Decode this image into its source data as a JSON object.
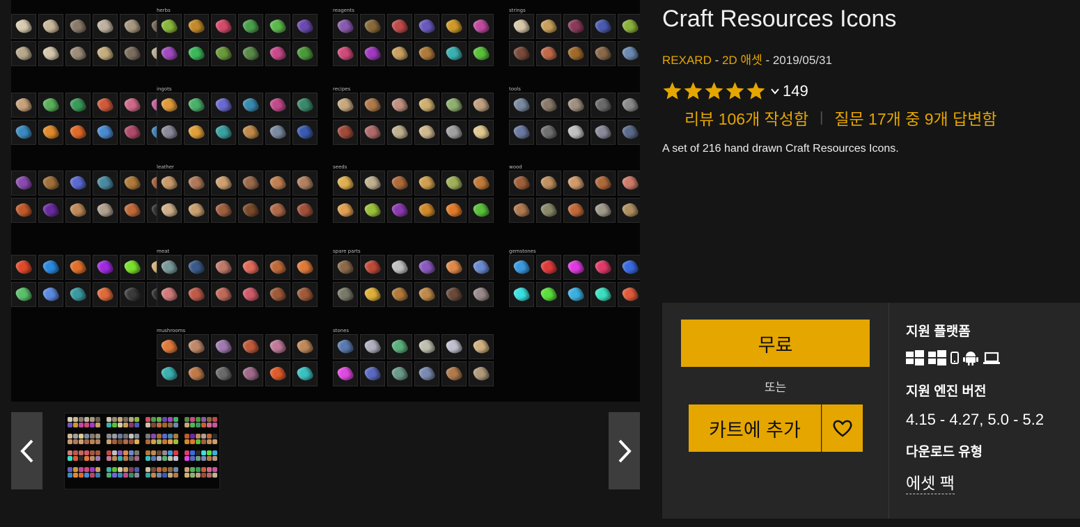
{
  "product": {
    "title": "Craft Resources Icons",
    "seller": "REXARD",
    "category": "2D 애셋",
    "date": "2019/05/31",
    "sep1": " - ",
    "sep2": " - ",
    "sep3": " - ",
    "rating": 5,
    "rating_count": "149",
    "reviews_link": "리뷰 106개 작성함",
    "review_sep": "|",
    "questions_link": "질문 17개 중 9개 답변함",
    "description": "A set of 216 hand drawn Craft Resources Icons."
  },
  "gallery": {
    "categories": [
      {
        "label": "",
        "colors": [
          "#d9cbb0",
          "#c9b89a",
          "#8a7a6a",
          "#bfb2a0",
          "#a89880",
          "#6d6252",
          "#b8a98c",
          "#d4c6ac",
          "#9c8c78",
          "#c6ad7f",
          "#7c6e5e",
          "#b5a78f"
        ]
      },
      {
        "label": "herbs",
        "colors": [
          "#8ab83a",
          "#c48a2a",
          "#d64a6a",
          "#4aa04a",
          "#5cb84a",
          "#6a4ab0",
          "#a04ac0",
          "#3ab85a",
          "#6a9a3a",
          "#5a8a4a",
          "#c84a8a",
          "#4a9a3a"
        ]
      },
      {
        "label": "reagents",
        "colors": [
          "#8a5ab0",
          "#8a6a3a",
          "#c04a4a",
          "#6a5ac0",
          "#d09a2a",
          "#c04aa0",
          "#d04a7a",
          "#a03ac0",
          "#c8a060",
          "#b07a3a",
          "#3ab0b0",
          "#5ac03a"
        ]
      },
      {
        "label": "strings",
        "colors": [
          "#d8c8a8",
          "#c8a05a",
          "#8a3a5a",
          "#4a5ab0",
          "#8ab03a",
          "#d0c0a0",
          "#7a4a3a",
          "#c06a4a",
          "#a06a2a",
          "#8a6a4a",
          "#6a8ab0",
          "#3a9ac0"
        ]
      },
      {
        "label": "",
        "colors": [
          "#c8a27a",
          "#5ab05a",
          "#3a9a5a",
          "#d05a3a",
          "#d06a8a",
          "#c05a9a",
          "#3a8ac0",
          "#e08a2a",
          "#e06a2a",
          "#4a8ad0",
          "#b04a6a",
          "#3a7ab0"
        ]
      },
      {
        "label": "ingots",
        "colors": [
          "#e09a3a",
          "#4ab06a",
          "#6a6ad0",
          "#3a8ab0",
          "#c04a8a",
          "#3a8a6a",
          "#8a8a9a",
          "#e0a03a",
          "#3aa0a0",
          "#c08a4a",
          "#7a8aa0",
          "#3a5ab0"
        ]
      },
      {
        "label": "recipes",
        "colors": [
          "#c8a880",
          "#b07a4a",
          "#c09080",
          "#d0b070",
          "#90b070",
          "#c0a080",
          "#a04a3a",
          "#b06a6a",
          "#c0b090",
          "#d0b890",
          "#a0a0a0",
          "#e0c890"
        ]
      },
      {
        "label": "tools",
        "colors": [
          "#7a8aa0",
          "#8a7a6a",
          "#a09080",
          "#6a6a6a",
          "#8a8a8a",
          "#9a9aa0",
          "#6a7aa0",
          "#707070",
          "#c0c0c0",
          "#8a8a9a",
          "#5a6a8a",
          "#7a7a7a"
        ]
      },
      {
        "label": "",
        "colors": [
          "#8a4ab0",
          "#a0703a",
          "#5a6ad0",
          "#4a8aa0",
          "#b07a3a",
          "#a05a3a",
          "#c05a2a",
          "#6a2aa0",
          "#c08a5a",
          "#b0a090",
          "#c06a3a",
          "#2a2a2a"
        ]
      },
      {
        "label": "leather",
        "colors": [
          "#c89a6a",
          "#b07a5a",
          "#d0a070",
          "#9a6a4a",
          "#c08050",
          "#b08060",
          "#d0b08a",
          "#c8a070",
          "#a06040",
          "#7a4a2a",
          "#b06a4a",
          "#a0503a"
        ]
      },
      {
        "label": "seeds",
        "colors": [
          "#e0b050",
          "#c0b090",
          "#b06a3a",
          "#d0a050",
          "#a0b05a",
          "#c07a3a",
          "#e0a050",
          "#9ac03a",
          "#8a3ab0",
          "#d08a2a",
          "#e07a2a",
          "#5ac03a"
        ]
      },
      {
        "label": "wood",
        "colors": [
          "#a0603a",
          "#c09060",
          "#d09a6a",
          "#b06a3a",
          "#d07a6a",
          "#c08a5a",
          "#b07a50",
          "#8a8a6a",
          "#c06a3a",
          "#a09a8a",
          "#b09060",
          "#c0a070"
        ]
      },
      {
        "label": "",
        "colors": [
          "#e04a2a",
          "#2a8ae0",
          "#e0702a",
          "#a02ae0",
          "#7ae02a",
          "#d0b070",
          "#5ac06a",
          "#5a8ae0",
          "#3a9aa0",
          "#e06a3a",
          "#3a3a3a",
          "#2a2a2a"
        ]
      },
      {
        "label": "meat",
        "colors": [
          "#7a9a9a",
          "#3a5a8a",
          "#c07a6a",
          "#e06a5a",
          "#c06a3a",
          "#e07a3a",
          "#d07a7a",
          "#c05a4a",
          "#c06a5a",
          "#d05a6a",
          "#a05a3a",
          "#a05a3a"
        ]
      },
      {
        "label": "spare parts",
        "colors": [
          "#8a6a4a",
          "#c04a3a",
          "#c0c0c0",
          "#8a5ac0",
          "#e08a4a",
          "#6a8ad0",
          "#7a7a6a",
          "#e0b03a",
          "#b07a3a",
          "#c08a4a",
          "#6a4a3a",
          "#9a8a8a"
        ]
      },
      {
        "label": "gemstones",
        "colors": [
          "#3a9ae0",
          "#e03a3a",
          "#e03ae0",
          "#e03a6a",
          "#3a6ae0",
          "#2a2a2a",
          "#3ae0e0",
          "#5ae03a",
          "#3ab0e0",
          "#3ae0c0",
          "#e05a3a",
          "#2a2a2a"
        ]
      },
      {
        "label": "mushrooms",
        "colors": [
          "#e07a3a",
          "#c08a6a",
          "#a07ab0",
          "#c05a3a",
          "#c07a9a",
          "#c08a5a",
          "#3ab0b0",
          "#c07a4a",
          "#6a6a6a",
          "#a06a8a",
          "#e05a2a",
          "#3ac0c0"
        ]
      },
      {
        "label": "stones",
        "colors": [
          "#5a7ab0",
          "#b0b0c0",
          "#5ab07a",
          "#c0c0b0",
          "#c0c0d0",
          "#d0b080",
          "#e04ae0",
          "#5a6ac0",
          "#6a9a8a",
          "#7a8ab0",
          "#b07a4a",
          "#b09a7a"
        ]
      }
    ]
  },
  "buy_box": {
    "free_label": "무료",
    "or_label": "또는",
    "cart_label": "카트에 추가",
    "platforms_heading": "지원 플랫폼",
    "engine_heading": "지원 엔진 버전",
    "engine_versions": "4.15 - 4.27, 5.0 - 5.2",
    "download_heading": "다운로드 유형",
    "download_type": "에셋 팩"
  },
  "colors": {
    "accent": "#e5a600",
    "background": "#151515",
    "panel": "#262626"
  },
  "icons": [
    "chevron-left-icon",
    "chevron-right-icon",
    "star-icon",
    "chevron-down-icon",
    "heart-icon",
    "windows-icon",
    "mobile-icon",
    "android-icon",
    "laptop-icon"
  ]
}
